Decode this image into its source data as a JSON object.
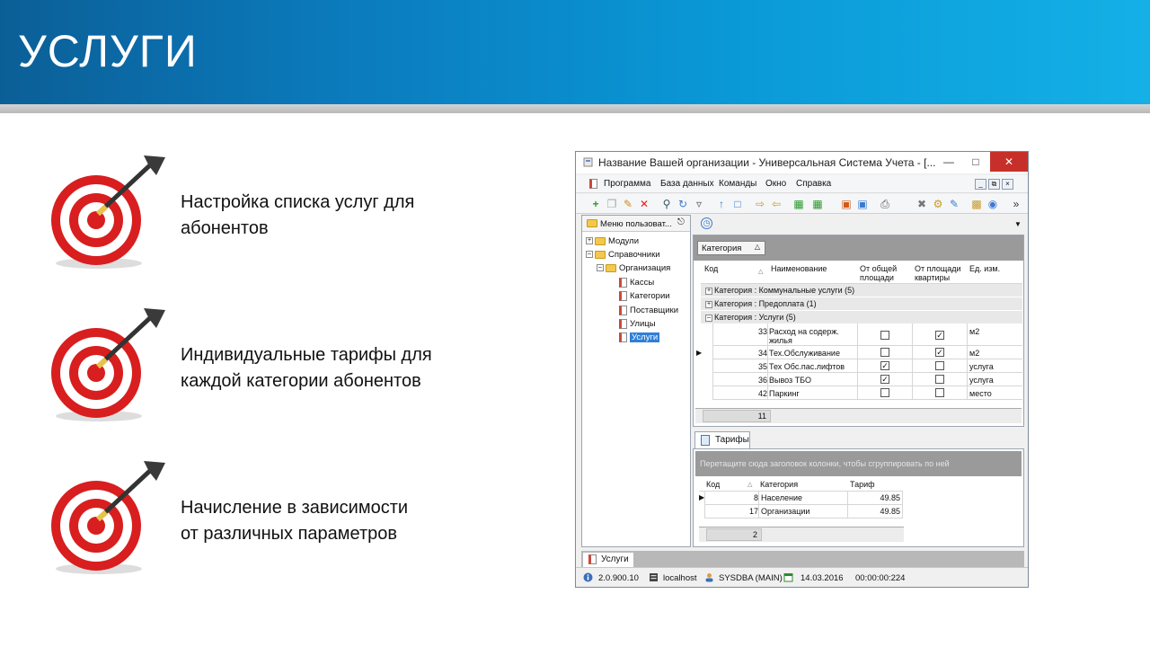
{
  "slide": {
    "title": "УСЛУГИ",
    "bullets": [
      {
        "line1": "Настройка списка услуг для",
        "line2": "абонентов"
      },
      {
        "line1": "Индивидуальные тарифы для",
        "line2": "каждой категории абонентов"
      },
      {
        "line1": "Начисление в зависимости",
        "line2": "от различных параметров"
      }
    ]
  },
  "app": {
    "window_title": "Название Вашей организации - Универсальная Система Учета - [...",
    "menu": [
      "Программа",
      "База данных",
      "Команды",
      "Окно",
      "Справка"
    ],
    "tree": {
      "header": "Меню пользоват...",
      "items": [
        {
          "label": "Модули"
        },
        {
          "label": "Справочники"
        },
        {
          "label": "Организация"
        },
        {
          "label": "Кассы"
        },
        {
          "label": "Категории"
        },
        {
          "label": "Поставщики"
        },
        {
          "label": "Улицы"
        },
        {
          "label": "Услуги"
        }
      ]
    },
    "services_grid": {
      "group_by_tag": "Категория",
      "columns": {
        "code": "Код",
        "name": "Наименование",
        "total_area_1": "От общей",
        "total_area_2": "площади",
        "apt_area_1": "От площади",
        "apt_area_2": "квартиры",
        "unit": "Ед. изм."
      },
      "groups": [
        "Категория : Коммунальные услуги (5)",
        "Категория : Предоплата (1)",
        "Категория : Услуги (5)"
      ],
      "rows": [
        {
          "code": "33",
          "name_1": "Расход на содерж.",
          "name_2": "жилья",
          "total": false,
          "apt": true,
          "unit": "м2"
        },
        {
          "code": "34",
          "name_1": "Тех.Обслуживание",
          "name_2": "",
          "total": false,
          "apt": true,
          "unit": "м2"
        },
        {
          "code": "35",
          "name_1": "Тех Обс.пас.лифтов",
          "name_2": "",
          "total": true,
          "apt": false,
          "unit": "услуга"
        },
        {
          "code": "36",
          "name_1": "Вывоз ТБО",
          "name_2": "",
          "total": true,
          "apt": false,
          "unit": "услуга"
        },
        {
          "code": "42",
          "name_1": "Паркинг",
          "name_2": "",
          "total": false,
          "apt": false,
          "unit": "место"
        }
      ],
      "footer_count": "11"
    },
    "tariffs": {
      "tab_label": "Тарифы",
      "drag_hint": "Перетащите сюда заголовок колонки, чтобы сгруппировать по ней",
      "columns": {
        "code": "Код",
        "category": "Категория",
        "tariff": "Тариф"
      },
      "rows": [
        {
          "code": "8",
          "category": "Население",
          "tariff": "49.85"
        },
        {
          "code": "17",
          "category": "Организации",
          "tariff": "49.85"
        }
      ],
      "footer_count": "2"
    },
    "doc_tab": "Услуги",
    "status": {
      "version": "2.0.900.10",
      "host": "localhost",
      "user": "SYSDBA (MAIN)",
      "date": "14.03.2016",
      "time": "00:00:00:224"
    }
  }
}
